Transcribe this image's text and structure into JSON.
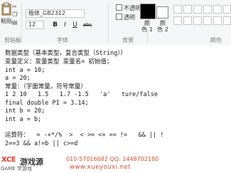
{
  "ribbon": {
    "paste_label": "粘贴",
    "clipboard_group": "剪贴板",
    "font_group": "字体",
    "background_group": "背景",
    "colors_group": "颜色",
    "font_name": "楷体_GB2312",
    "font_size": "12",
    "bold": "B",
    "italic": "I",
    "underline": "U",
    "strike": "abc",
    "opaque_label": "不透明",
    "transparent_label": "透明",
    "color1_label": "颜\n色 1",
    "color2_label": "颜\n色 2",
    "color1_hex": "#000000",
    "color2_hex": "#ffffff"
  },
  "code": {
    "lines": [
      "数据类型（基本类型，复合类型（String））",
      "变量定义：变量类型 变量名= 初始值；",
      "int a = 10;",
      "a = 20;",
      "常量：（字面常量，符号常量）",
      "1 2 10   1.5   1.7 -1.5   'a'   ture/false",
      "final double PI = 3.14;",
      "int b = 20;",
      "int a = b;",
      "",
      "运算符：  = -+*/%  >  < >= <= == !=   && || !",
      "2==3 && a!=b || c>=d"
    ]
  },
  "watermark": {
    "logo": "XCE",
    "name_cn": "游戏源",
    "phone": "010-57016682  QQ: 1448702180",
    "url": "www.xueyouxi.net",
    "sub": "GAME 学游戏"
  }
}
